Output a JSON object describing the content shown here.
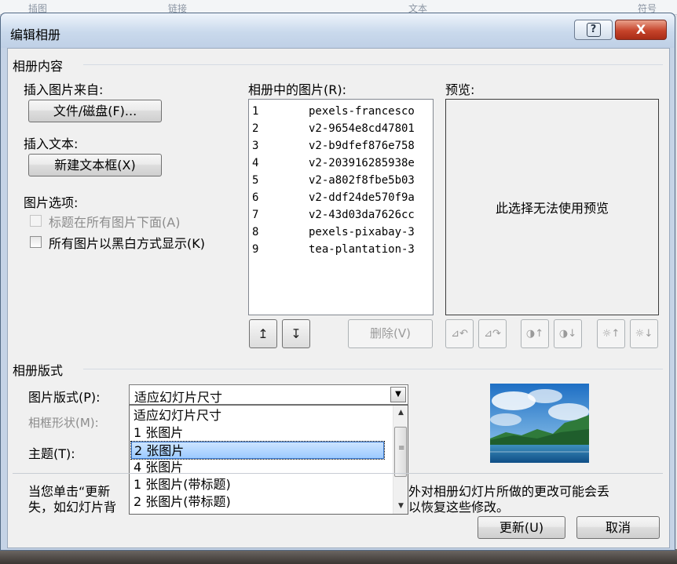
{
  "background": {
    "table_header": [
      "插图",
      "链接",
      "文本",
      "符号"
    ]
  },
  "dialog": {
    "title": "编辑相册",
    "help_icon_glyph": "?",
    "close_icon_glyph": "X"
  },
  "content_group": {
    "title": "相册内容",
    "insert_from_label": "插入图片来自:",
    "file_disk_button": "文件/磁盘(F)...",
    "insert_text_label": "插入文本:",
    "new_textbox_button": "新建文本框(X)",
    "picture_options_label": "图片选项:",
    "captions_below_label": "标题在所有图片下面(A)",
    "all_bw_label": "所有图片以黑白方式显示(K)"
  },
  "pictures": {
    "label": "相册中的图片(R):",
    "items": [
      {
        "num": "1",
        "name": "pexels-francesco"
      },
      {
        "num": "2",
        "name": "v2-9654e8cd47801"
      },
      {
        "num": "3",
        "name": "v2-b9dfef876e758"
      },
      {
        "num": "4",
        "name": "v2-203916285938e"
      },
      {
        "num": "5",
        "name": "v2-a802f8fbe5b03"
      },
      {
        "num": "6",
        "name": "v2-ddf24de570f9a"
      },
      {
        "num": "7",
        "name": "v2-43d03da7626cc"
      },
      {
        "num": "8",
        "name": "pexels-pixabay-3"
      },
      {
        "num": "9",
        "name": "tea-plantation-3"
      }
    ],
    "move_up_glyph": "↥",
    "move_down_glyph": "↧",
    "delete_button": "删除(V)"
  },
  "preview": {
    "label": "预览:",
    "message": "此选择无法使用预览",
    "tool_glyphs": [
      "⊿↶",
      "⊿↷",
      "◑↑",
      "◑↓",
      "☼↑",
      "☼↓"
    ]
  },
  "layout_group": {
    "title": "相册版式",
    "picture_layout_label": "图片版式(P):",
    "picture_layout_value": "适应幻灯片尺寸",
    "frame_shape_label": "相框形状(M):",
    "theme_label": "主题(T):",
    "dropdown_options": [
      "适应幻灯片尺寸",
      "1 张图片",
      "2 张图片",
      "4 张图片",
      "1 张图片(带标题)",
      "2 张图片(带标题)"
    ],
    "dropdown_selected_index": 2
  },
  "note": {
    "line1_a": "当您单击“更新",
    "line1_b": "外对相册幻灯片所做的更改可能会丢",
    "line2_a": "失，如幻灯片背",
    "line2_b": "以恢复这些修改。"
  },
  "buttons": {
    "update": "更新(U)",
    "cancel": "取消"
  }
}
